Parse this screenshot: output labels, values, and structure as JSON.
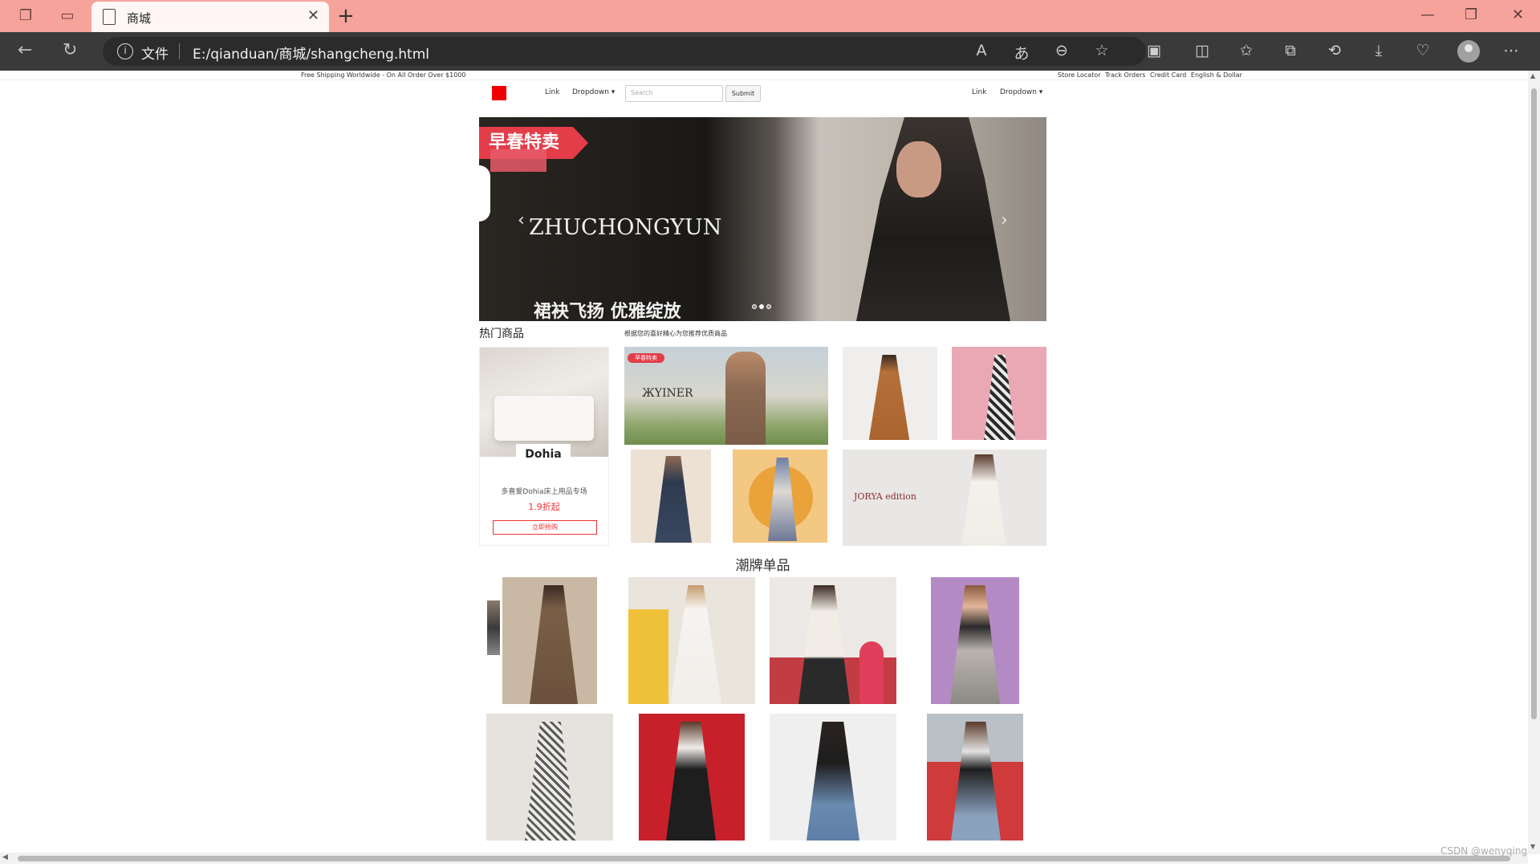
{
  "browser": {
    "tab_title": "商城",
    "protocol_label": "文件",
    "url": "E:/qianduan/商城/shangcheng.html",
    "watermark": "CSDN @wenyqing"
  },
  "topbar": {
    "left_text": "Free Shipping Worldwide - On All Order Over $1000",
    "right_links": [
      "Store Locator",
      "Track Orders",
      "Credit Card",
      "English & Dollar"
    ]
  },
  "navbar": {
    "link_left": "Link",
    "dropdown_left": "Dropdown ▾",
    "search_placeholder": "Search",
    "submit_label": "Submit",
    "link_right": "Link",
    "dropdown_right": "Dropdown ▾"
  },
  "carousel": {
    "sale_tag": "早春特卖",
    "brand": "ZHUCHONGYUN",
    "slogan": "裙袂飞扬 优雅绽放",
    "prev": "‹",
    "next": "›",
    "slide_count": 3,
    "active_slide": 2
  },
  "hot": {
    "title": "热门商品",
    "subtitle": "根据您的喜好精心为您推荐优质商品",
    "dohia": {
      "logo": "Dohia",
      "desc": "多喜爱Dohia床上用品专场",
      "price": "1.9折起",
      "buy": "立即抢购"
    },
    "yiner_logo": "ЖYINER",
    "yiner_tag": "早春特卖",
    "jorya": "JORYA edition"
  },
  "trend": {
    "title": "潮牌单品"
  },
  "colors": {
    "tabbar": "#f6a39b",
    "addrbar": "#3a3a3a",
    "brand_red": "#ee0000",
    "accent_red": "#e33d4a"
  }
}
